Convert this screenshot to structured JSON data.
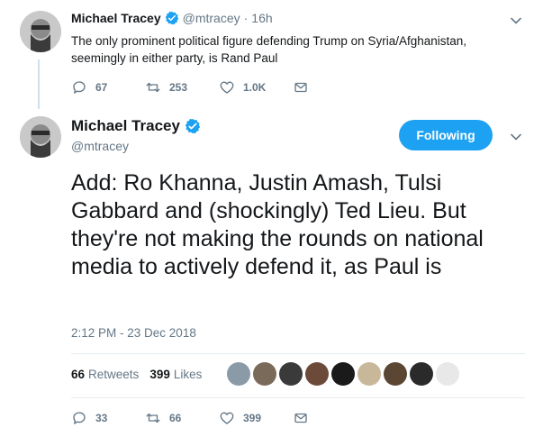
{
  "parent_tweet": {
    "name": "Michael Tracey",
    "handle": "@mtracey",
    "separator": "·",
    "time": "16h",
    "text": "The only prominent political figure defending Trump on Syria/Afghanistan, seemingly in either party, is Rand Paul",
    "replies": "67",
    "retweets": "253",
    "likes": "1.0K"
  },
  "main_tweet": {
    "name": "Michael Tracey",
    "handle": "@mtracey",
    "follow_label": "Following",
    "text": "Add: Ro Khanna, Justin Amash, Tulsi Gabbard and (shockingly) Ted Lieu. But they're not making the rounds on national media to actively defend it, as Paul is",
    "timestamp": "2:12 PM - 23 Dec 2018",
    "retweet_count": "66",
    "retweet_label": "Retweets",
    "like_count": "399",
    "like_label": "Likes",
    "replies": "33",
    "retweets": "66",
    "likes": "399"
  },
  "liker_avatars": [
    {
      "color": "#8a9aa6"
    },
    {
      "color": "#7a6a5a"
    },
    {
      "color": "#3a3a3a"
    },
    {
      "color": "#6b4a3a"
    },
    {
      "color": "#1a1a1a"
    },
    {
      "color": "#c9b79a"
    },
    {
      "color": "#5a4632"
    },
    {
      "color": "#2a2a2a"
    },
    {
      "color": "#e8e8e8"
    }
  ],
  "colors": {
    "accent": "#1da1f2",
    "text": "#14171a",
    "muted": "#657786"
  }
}
